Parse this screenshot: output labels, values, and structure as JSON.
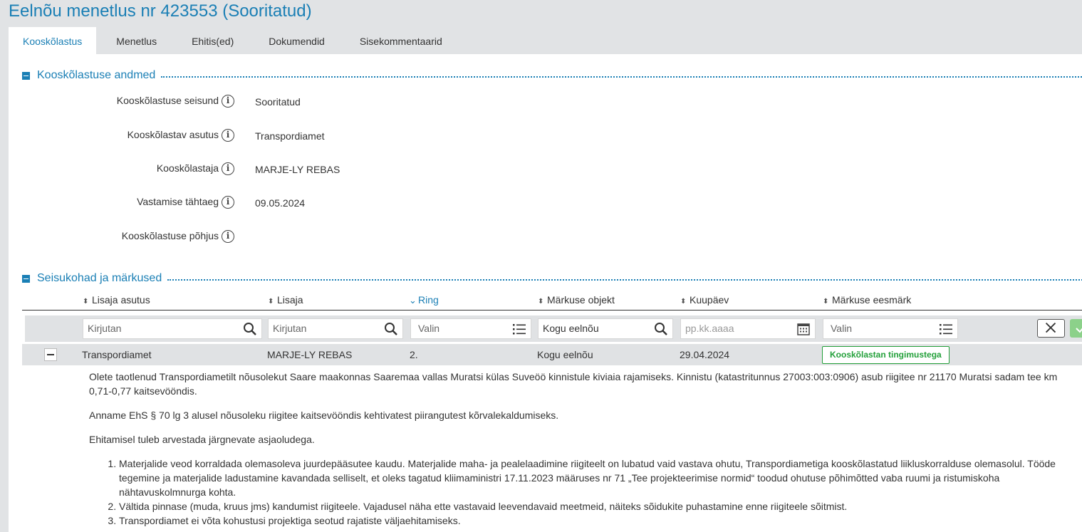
{
  "page": {
    "title": "Eelnõu menetlus nr 423553 (Sooritatud)"
  },
  "tabs": [
    {
      "label": "Kooskõlastus",
      "active": true
    },
    {
      "label": "Menetlus",
      "active": false
    },
    {
      "label": "Ehitis(ed)",
      "active": false
    },
    {
      "label": "Dokumendid",
      "active": false
    },
    {
      "label": "Sisekommentaarid",
      "active": false
    }
  ],
  "section1": {
    "title": "Kooskõlastuse andmed",
    "fields": [
      {
        "label": "Kooskõlastuse seisund",
        "value": "Sooritatud"
      },
      {
        "label": "Kooskõlastav asutus",
        "value": "Transpordiamet"
      },
      {
        "label": "Kooskõlastaja",
        "value": "MARJE-LY REBAS"
      },
      {
        "label": "Vastamise tähtaeg",
        "value": "09.05.2024"
      },
      {
        "label": "Kooskõlastuse põhjus",
        "value": ""
      }
    ]
  },
  "section2": {
    "title": "Seisukohad ja märkused",
    "columns": [
      "Lisaja asutus",
      "Lisaja",
      "Ring",
      "Märkuse objekt",
      "Kuupäev",
      "Märkuse eesmärk"
    ],
    "filters": {
      "lisaja_asutus": "Kirjutan",
      "lisaja": "Kirjutan",
      "ring": "Valin",
      "objekt": "Kogu eelnõu",
      "kuupaev_placeholder": "pp.kk.aaaa",
      "eesmark": "Valin"
    },
    "row": {
      "asutus": "Transpordiamet",
      "lisaja": "MARJE-LY REBAS",
      "ring": "2.",
      "objekt": "Kogu eelnõu",
      "kuupaev": "29.04.2024",
      "eesmark": "Kooskõlastan tingimustega"
    },
    "detail": {
      "p1": "Olete taotlenud Transpordiametilt nõusolekut Saare maakonnas Saaremaa vallas Muratsi külas Suveöö kinnistule kiviaia rajamiseks. Kinnistu (katastritunnus 27003:003:0906) asub riigitee nr 21170 Muratsi sadam tee km 0,71-0,77 kaitsevööndis.",
      "p2": "Anname EhS § 70 lg 3 alusel nõusoleku riigitee kaitsevööndis kehtivatest piirangutest kõrvalekaldumiseks.",
      "p3": "Ehitamisel tuleb arvestada järgnevate asjaoludega.",
      "items": [
        "Materjalide veod korraldada olemasoleva juurdepääsutee kaudu. Materjalide maha- ja pealelaadimine riigiteelt on lubatud vaid vastava ohutu, Transpordiametiga kooskõlastatud liikluskorralduse olemasolul. Tööde tegemine ja materjalide ladustamine kavandada selliselt, et oleks tagatud kliimaministri 17.11.2023 määruses nr 71 „Tee projekteerimise normid“ toodud ohutuse põhimõtted vaba ruumi ja ristumiskoha nähtavuskolmnurga kohta.",
        "Vältida pinnase (muda, kruus jms) kandumist riigiteele. Vajadusel näha ette vastavaid leevendavaid meetmeid, näiteks sõidukite puhastamine enne riigiteele sõitmist.",
        "Transpordiamet ei võta kohustusi projektiga seotud rajatiste väljaehitamiseks."
      ]
    }
  },
  "colors": {
    "accent": "#1a7fb5",
    "success": "#23a03a",
    "panel": "#e0e2e4"
  },
  "icons": [
    "info-icon",
    "search-icon",
    "list-icon",
    "calendar-icon",
    "close-icon",
    "check-icon",
    "sort-icon",
    "collapse-icon"
  ]
}
